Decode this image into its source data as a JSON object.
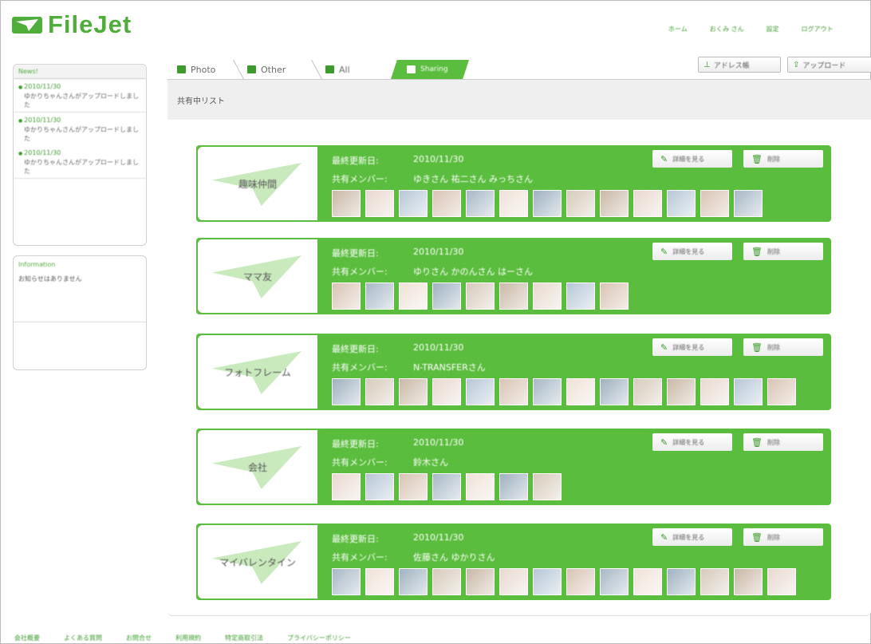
{
  "header": {
    "logo_text": "FileJet",
    "nav": [
      "ホーム",
      "おくみ さん",
      "設定",
      "ログアウト"
    ]
  },
  "sidebar": {
    "news": {
      "title": "News!",
      "items": [
        {
          "date": "2010/11/30",
          "text": "ゆかりちゃんさんがアップロードしました"
        },
        {
          "date": "2010/11/30",
          "text": "ゆかりちゃんさんがアップロードしました"
        },
        {
          "date": "2010/11/30",
          "text": "ゆかりちゃんさんがアップロードしました"
        }
      ]
    },
    "information": {
      "title": "Information",
      "body": "お知らせはありません"
    }
  },
  "tabs": [
    {
      "label": "Photo",
      "icon": "camera-icon",
      "active": false
    },
    {
      "label": "Other",
      "icon": "folder-icon",
      "active": false
    },
    {
      "label": "All",
      "icon": "film-icon",
      "active": false
    },
    {
      "label": "Sharing",
      "icon": "people-icon",
      "active": true
    }
  ],
  "toolbar": {
    "address_book": "アドレス帳",
    "upload": "アップロード"
  },
  "page_title": "共有中リスト",
  "labels": {
    "last_updated": "最終更新日:",
    "members": "共有メンバー:",
    "detail_button": "詳細を見る",
    "delete_button": "削除"
  },
  "groups": [
    {
      "name": "趣味仲間",
      "updated": "2010/11/30",
      "members": "ゆきさん 祐二さん みっちさん",
      "thumb_count": 13
    },
    {
      "name": "ママ友",
      "updated": "2010/11/30",
      "members": "ゆりさん かのんさん はーさん",
      "thumb_count": 9
    },
    {
      "name": "フォトフレーム",
      "updated": "2010/11/30",
      "members": "N-TRANSFERさん",
      "thumb_count": 14
    },
    {
      "name": "会社",
      "updated": "2010/11/30",
      "members": "鈴木さん",
      "thumb_count": 7
    },
    {
      "name": "マイバレンタイン",
      "updated": "2010/11/30",
      "members": "佐藤さん ゆかりさん",
      "thumb_count": 14
    }
  ],
  "footer": [
    "会社概要",
    "よくある質問",
    "お問合せ",
    "利用規約",
    "特定商取引法",
    "プライバシーポリシー"
  ],
  "colors": {
    "accent": "#5bbd3e",
    "link": "#3c9b2c"
  }
}
